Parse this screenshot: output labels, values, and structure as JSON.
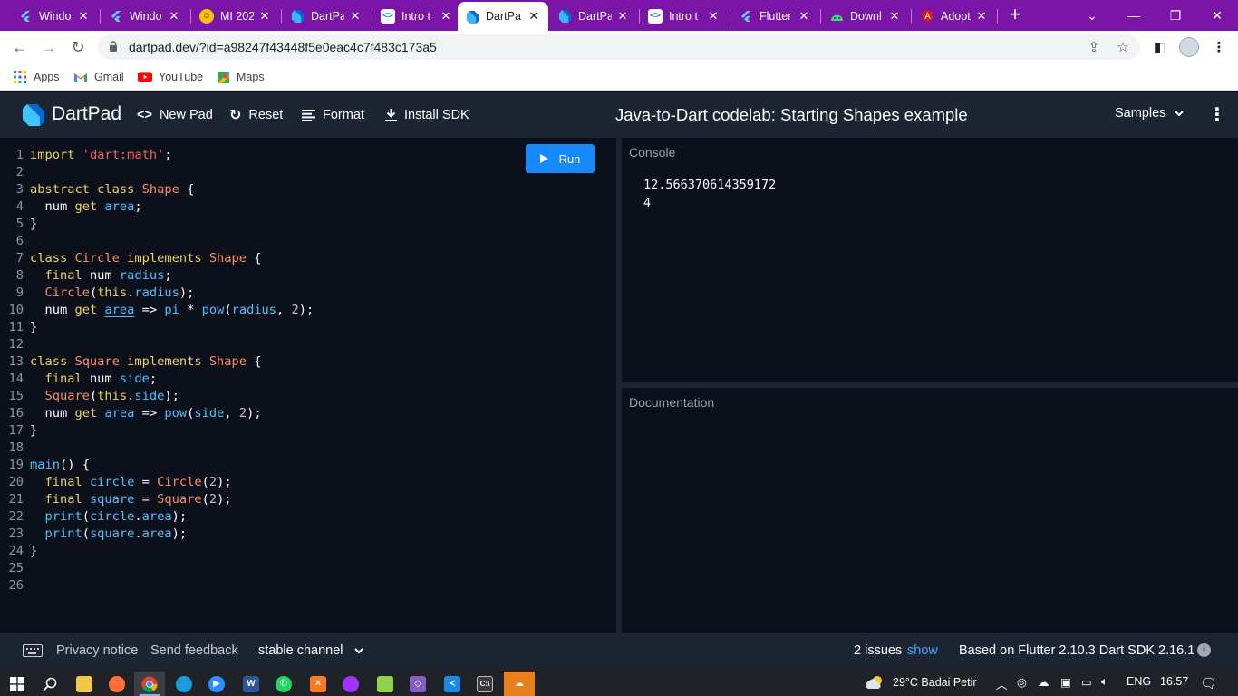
{
  "browser": {
    "tabs": [
      {
        "label": "Windo",
        "icon": "flutter-icon",
        "active": false
      },
      {
        "label": "Windo",
        "icon": "flutter-icon",
        "active": false
      },
      {
        "label": "MI 202",
        "icon": "emoji-icon",
        "active": false
      },
      {
        "label": "DartPa",
        "icon": "dartpad-icon",
        "active": false
      },
      {
        "label": "Intro t",
        "icon": "codelab-icon",
        "active": false
      },
      {
        "label": "DartPa",
        "icon": "dartpad-icon",
        "active": true
      },
      {
        "label": "DartPa",
        "icon": "dartpad-icon",
        "active": false
      },
      {
        "label": "Intro t",
        "icon": "codelab-icon",
        "active": false
      },
      {
        "label": "Flutter",
        "icon": "flutter-icon",
        "active": false
      },
      {
        "label": "Downl",
        "icon": "android-icon",
        "active": false
      },
      {
        "label": "Adopt",
        "icon": "angular-icon",
        "active": false
      }
    ],
    "url": "dartpad.dev/?id=a98247f43448f5e0eac4c7f483c173a5",
    "bookmarks": [
      {
        "label": "Apps",
        "icon": "apps-grid-icon"
      },
      {
        "label": "Gmail",
        "icon": "gmail-icon"
      },
      {
        "label": "YouTube",
        "icon": "youtube-icon"
      },
      {
        "label": "Maps",
        "icon": "maps-icon"
      }
    ]
  },
  "header": {
    "brand": "DartPad",
    "new_pad": "New Pad",
    "reset": "Reset",
    "format": "Format",
    "install_sdk": "Install SDK",
    "title": "Java-to-Dart codelab: Starting Shapes example",
    "samples": "Samples"
  },
  "editor": {
    "run_label": "Run",
    "lines": [
      "import 'dart:math';",
      "",
      "abstract class Shape {",
      "  num get area;",
      "}",
      "",
      "class Circle implements Shape {",
      "  final num radius;",
      "  Circle(this.radius);",
      "  num get area => pi * pow(radius, 2);",
      "}",
      "",
      "class Square implements Shape {",
      "  final num side;",
      "  Square(this.side);",
      "  num get area => pow(side, 2);",
      "}",
      "",
      "main() {",
      "  final circle = Circle(2);",
      "  final square = Square(2);",
      "  print(circle.area);",
      "  print(square.area);",
      "}",
      "",
      ""
    ]
  },
  "console": {
    "title": "Console",
    "output": [
      "12.566370614359172",
      "4"
    ]
  },
  "docs": {
    "title": "Documentation"
  },
  "footer": {
    "privacy": "Privacy notice",
    "feedback": "Send feedback",
    "channel": "stable channel",
    "issues": "2 issues",
    "show": "show",
    "version": "Based on Flutter 2.10.3 Dart SDK 2.16.1"
  },
  "taskbar": {
    "weather": "29°C  Badai Petir",
    "lang": "ENG",
    "time": "16.57"
  },
  "colors": {
    "tab_strip": "#7b15a8",
    "header": "#1d2532",
    "editor_bg": "#0b101a",
    "run_button": "#168afd",
    "link": "#3ea6ff"
  }
}
